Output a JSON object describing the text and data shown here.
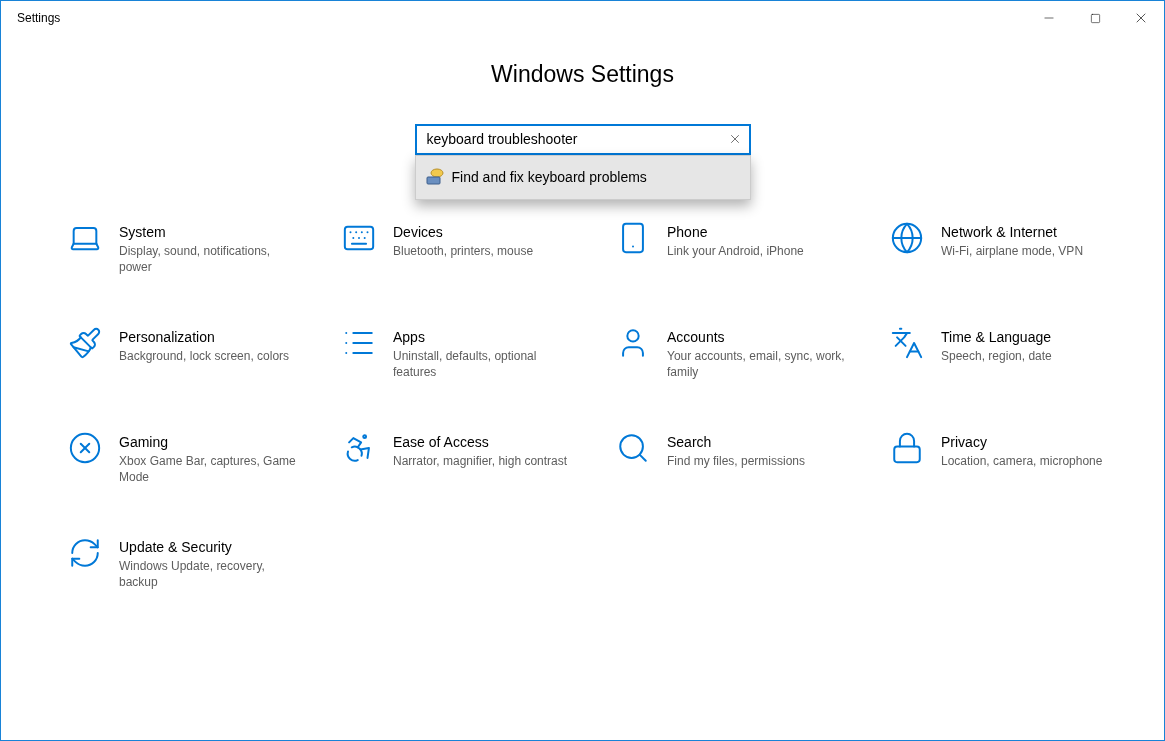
{
  "window": {
    "title": "Settings"
  },
  "heading": "Windows Settings",
  "search": {
    "value": "keyboard troubleshooter",
    "suggestions": [
      {
        "label": "Find and fix keyboard problems",
        "selected": true
      }
    ]
  },
  "categories": [
    {
      "title": "System",
      "description": "Display, sound, notifications, power"
    },
    {
      "title": "Devices",
      "description": "Bluetooth, printers, mouse"
    },
    {
      "title": "Phone",
      "description": "Link your Android, iPhone"
    },
    {
      "title": "Network & Internet",
      "description": "Wi-Fi, airplane mode, VPN"
    },
    {
      "title": "Personalization",
      "description": "Background, lock screen, colors"
    },
    {
      "title": "Apps",
      "description": "Uninstall, defaults, optional features"
    },
    {
      "title": "Accounts",
      "description": "Your accounts, email, sync, work, family"
    },
    {
      "title": "Time & Language",
      "description": "Speech, region, date"
    },
    {
      "title": "Gaming",
      "description": "Xbox Game Bar, captures, Game Mode"
    },
    {
      "title": "Ease of Access",
      "description": "Narrator, magnifier, high contrast"
    },
    {
      "title": "Search",
      "description": "Find my files, permissions"
    },
    {
      "title": "Privacy",
      "description": "Location, camera, microphone"
    },
    {
      "title": "Update & Security",
      "description": "Windows Update, recovery, backup"
    }
  ]
}
